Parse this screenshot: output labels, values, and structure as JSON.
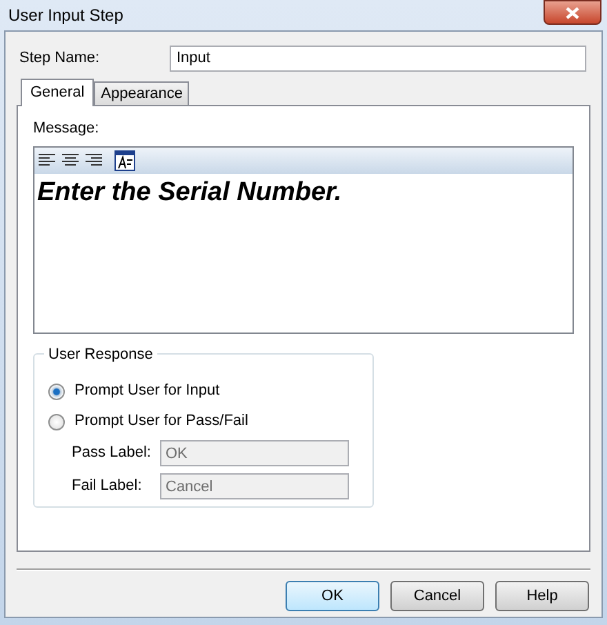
{
  "window": {
    "title": "User Input Step"
  },
  "step_name": {
    "label": "Step Name:",
    "value": "Input"
  },
  "tabs": [
    {
      "label": "General",
      "selected": true
    },
    {
      "label": "Appearance",
      "selected": false
    }
  ],
  "message": {
    "label": "Message:",
    "text": "Enter the Serial Number."
  },
  "user_response": {
    "title": "User Response",
    "options": [
      {
        "label": "Prompt User for Input",
        "selected": true
      },
      {
        "label": "Prompt User for Pass/Fail",
        "selected": false
      }
    ],
    "fields": [
      {
        "label": "Pass Label:",
        "value": "OK",
        "disabled": true
      },
      {
        "label": "Fail Label:",
        "value": "Cancel",
        "disabled": true
      }
    ]
  },
  "buttons": [
    {
      "label": "OK",
      "default": true
    },
    {
      "label": "Cancel",
      "default": false
    },
    {
      "label": "Help",
      "default": false
    }
  ]
}
